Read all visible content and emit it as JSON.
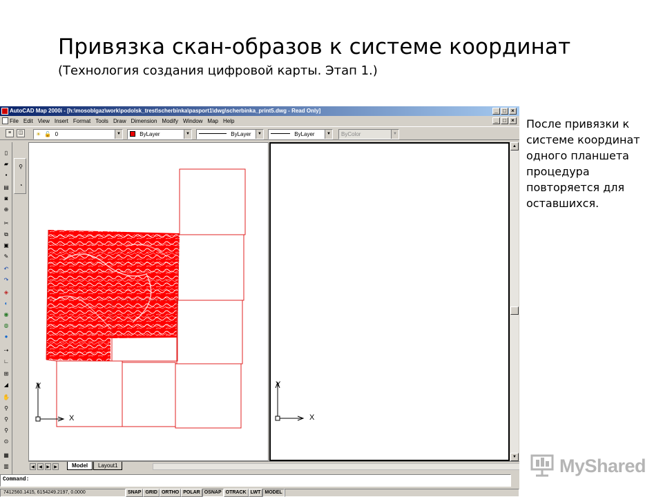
{
  "slide": {
    "title": "Привязка скан-образов к системе координат",
    "subtitle": "(Технология создания цифровой карты. Этап 1.)",
    "note": "После привязки к системе координат одного планшета процедура повторяется для оставшихся."
  },
  "acad": {
    "window_title": "AutoCAD Map 2000i - [h:\\mosoblgaz\\work\\podolsk_trest\\scherbinka\\pasport1\\dwg\\scherbinka_print5.dwg - Read Only]",
    "window_buttons": [
      "_",
      "□",
      "×"
    ],
    "menu": [
      "File",
      "Edit",
      "View",
      "Insert",
      "Format",
      "Tools",
      "Draw",
      "Dimension",
      "Modify",
      "Window",
      "Map",
      "Help"
    ],
    "properties": {
      "layer": "0",
      "color": "ByLayer",
      "linetype": "ByLayer",
      "lineweight": "ByLayer",
      "plotstyle": "ByColor"
    },
    "ucs": {
      "x_label": "X",
      "y_label": "Y"
    },
    "tabs": [
      {
        "label": "Model",
        "active": true
      },
      {
        "label": "Layout1",
        "active": false
      }
    ],
    "command_prompt": "Command:",
    "coordinates": "7412560.1415, 6154249.2197, 0.0000",
    "status_buttons": [
      {
        "label": "SNAP",
        "on": false
      },
      {
        "label": "GRID",
        "on": false
      },
      {
        "label": "ORTHO",
        "on": false
      },
      {
        "label": "POLAR",
        "on": false
      },
      {
        "label": "OSNAP",
        "on": true
      },
      {
        "label": "OTRACK",
        "on": false
      },
      {
        "label": "LWT",
        "on": false
      },
      {
        "label": "MODEL",
        "on": true
      }
    ],
    "colors": {
      "grid_line": "#e02020",
      "scan_fill": "#ff0000",
      "title_bar_start": "#0a246a",
      "title_bar_end": "#a6caf0"
    }
  },
  "watermark": {
    "text": "MyShared"
  }
}
